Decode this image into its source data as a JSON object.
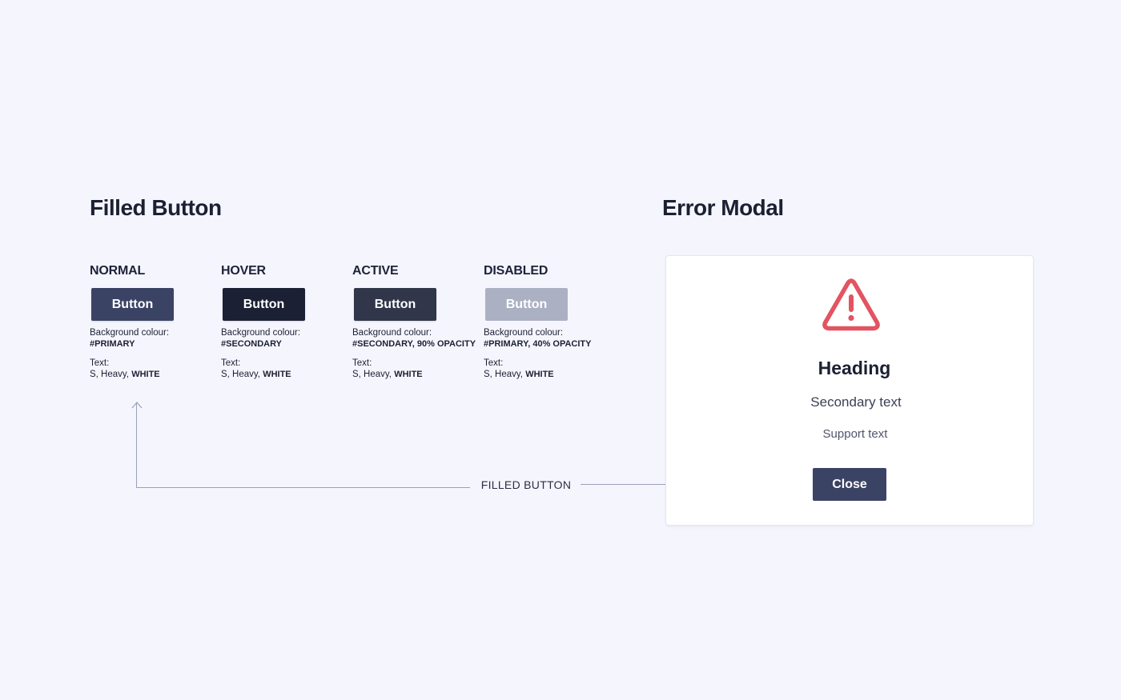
{
  "titles": {
    "filled_button": "Filled Button",
    "error_modal": "Error Modal"
  },
  "states": [
    {
      "label": "NORMAL",
      "button_label": "Button",
      "bg_caption": "Background colour:",
      "bg_value": "#PRIMARY",
      "text_caption": "Text:",
      "text_value": "S, Heavy, ",
      "text_color": "WHITE",
      "color": "#3b4365"
    },
    {
      "label": "HOVER",
      "button_label": "Button",
      "bg_caption": "Background colour:",
      "bg_value": "#SECONDARY",
      "text_caption": "Text:",
      "text_value": "S, Heavy, ",
      "text_color": "WHITE",
      "color": "#1c2035"
    },
    {
      "label": "ACTIVE",
      "button_label": "Button",
      "bg_caption": "Background colour:",
      "bg_value": "#SECONDARY,  90% OPACITY",
      "text_caption": "Text:",
      "text_value": "S, Heavy, ",
      "text_color": "WHITE",
      "color": "#31364a"
    },
    {
      "label": "DISABLED",
      "button_label": "Button",
      "bg_caption": "Background colour:",
      "bg_value": "#PRIMARY,  40% OPACITY",
      "text_caption": "Text:",
      "text_value": "S, Heavy, ",
      "text_color": "WHITE",
      "color": "#acb0c3"
    }
  ],
  "connector": {
    "label": "FILLED BUTTON",
    "line_color": "#9aa0b8"
  },
  "modal": {
    "icon": "warning-triangle-icon",
    "icon_color": "#e25461",
    "heading": "Heading",
    "secondary_text": "Secondary text",
    "support_text": "Support text",
    "button_label": "Close",
    "button_color": "#3b4365"
  }
}
